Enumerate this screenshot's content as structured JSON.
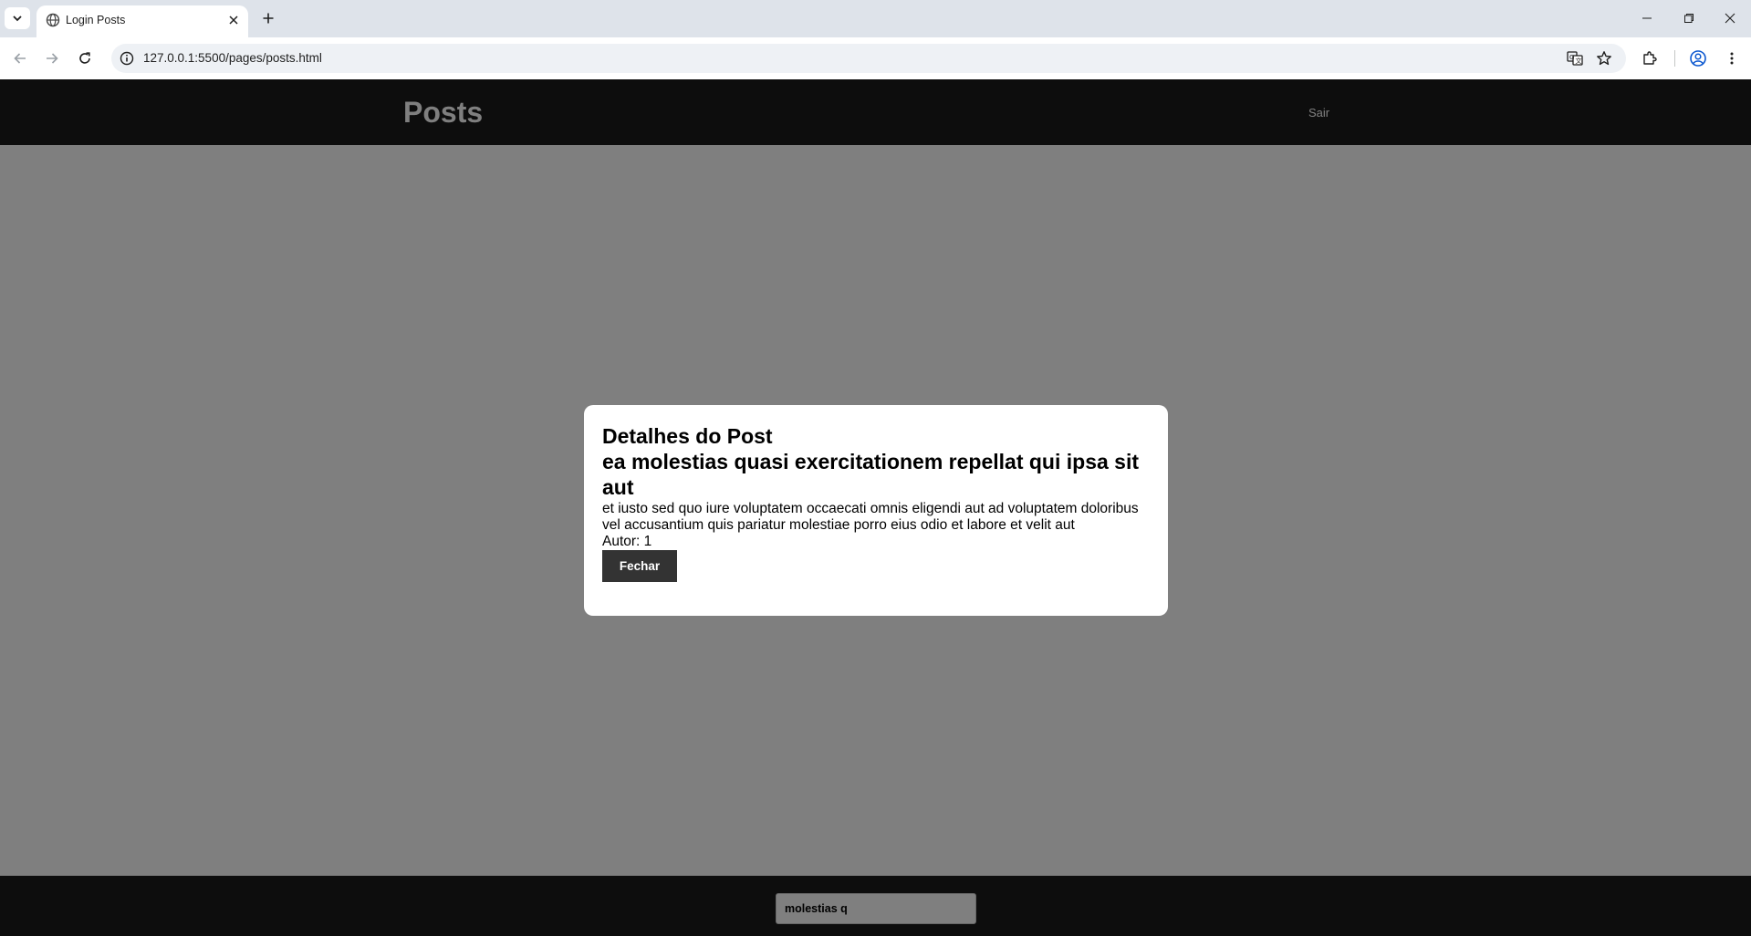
{
  "browser": {
    "tab_title": "Login Posts",
    "url": "127.0.0.1:5500/pages/posts.html"
  },
  "page": {
    "header_title": "Posts",
    "logout_label": "Sair",
    "search_value": "molestias q"
  },
  "modal": {
    "heading": "Detalhes do Post",
    "post_title": "ea molestias quasi exercitationem repellat qui ipsa sit aut",
    "post_body": "et iusto sed quo iure voluptatem occaecati omnis eligendi aut ad voluptatem doloribus vel accusantium quis pariatur molestiae porro eius odio et labore et velit aut",
    "author_label": "Autor: 1",
    "close_label": "Fechar"
  }
}
